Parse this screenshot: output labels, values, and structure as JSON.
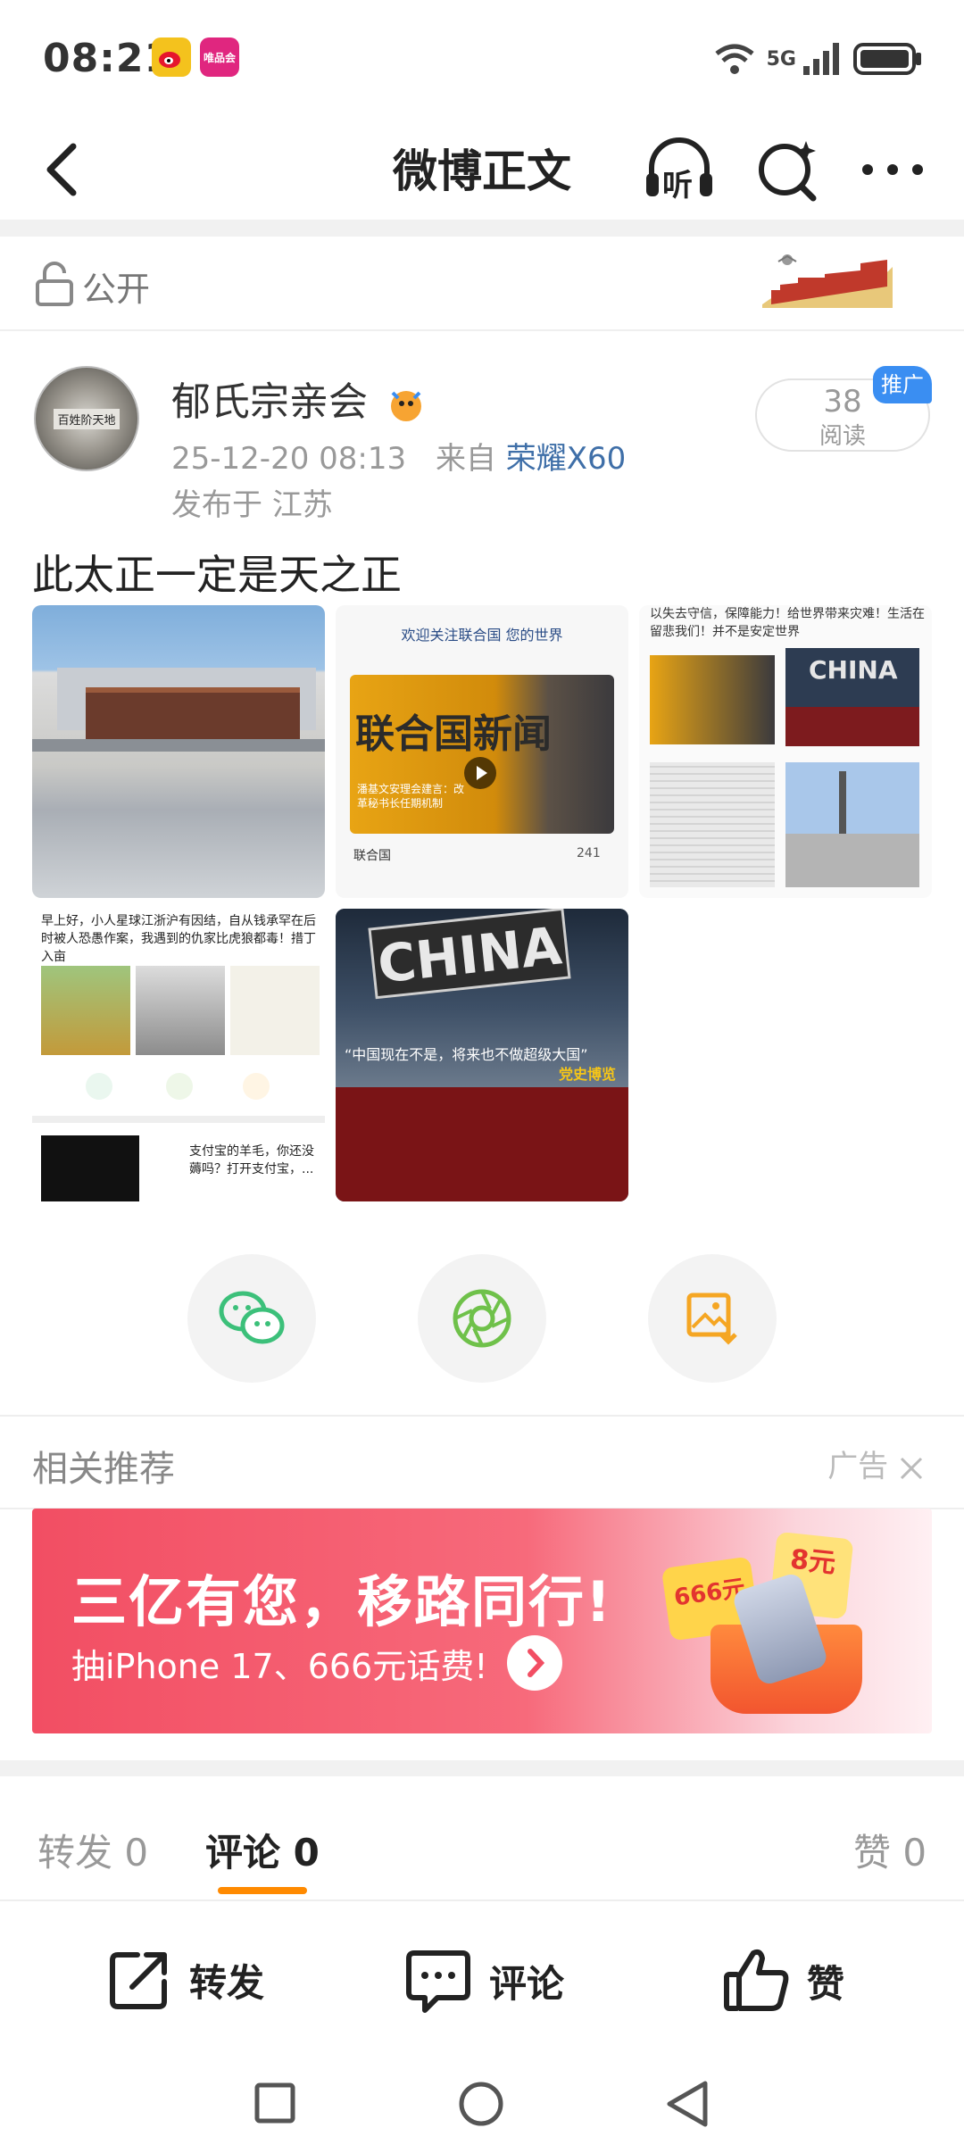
{
  "status_bar": {
    "time": "08:21",
    "app1": "微博",
    "app2": "唯品会",
    "network": "5G"
  },
  "nav": {
    "title": "微博正文",
    "listen_label": "听"
  },
  "visibility": {
    "label": "公开"
  },
  "post": {
    "author": "郁氏宗亲会",
    "avatar_text": "百姓阶天地",
    "time": "25-12-20 08:13",
    "from_label": "来自",
    "device": "荣耀X60",
    "location": "发布于 江苏",
    "reads_count": "38",
    "reads_label": "阅读",
    "promo_badge": "推广",
    "text": "此太正一定是天之正"
  },
  "images": {
    "img2_header": "欢迎关注联合国 您的世界",
    "img2_title": "联合国新闻",
    "img2_caption": "潘基文安理会建言：改革秘书长任期机制",
    "img2_source": "联合国",
    "img2_likes": "241",
    "img3_text": "以失去守信，保障能力！给世界带来灾难！生活在留悲我们！并不是安定世界",
    "img3_china": "CHINA",
    "img4_text": "早上好，小人星球江浙沪有因结，自从钱承罕在后时被人恐愚作案，我遇到的仇家比虎狼都毒！措丁入亩",
    "img4_ad_text": "支付宝的羊毛，你还没薅吗？打开支付宝，...",
    "img5_china": "CHINA",
    "img5_subtitle": "“中国现在不是，将来也不做超级大国”",
    "img5_watermark": "党史博览"
  },
  "related": {
    "title": "相关推荐",
    "ad_label": "广告",
    "banner_headline": "三亿有您，移路同行!",
    "banner_sub": "抽iPhone 17、666元话费!",
    "banner_badge1": "666元",
    "banner_badge2": "8元"
  },
  "tabs": {
    "repost": "转发 0",
    "comment": "评论 0",
    "like": "赞 0"
  },
  "actions": {
    "repost": "转发",
    "comment": "评论",
    "like": "赞"
  },
  "colors": {
    "accent_orange": "#ff8a00",
    "link_blue": "#3f6fa8",
    "wechat_green": "#3cc07a",
    "moments_green": "#6fc14a",
    "save_orange": "#f5a623"
  }
}
